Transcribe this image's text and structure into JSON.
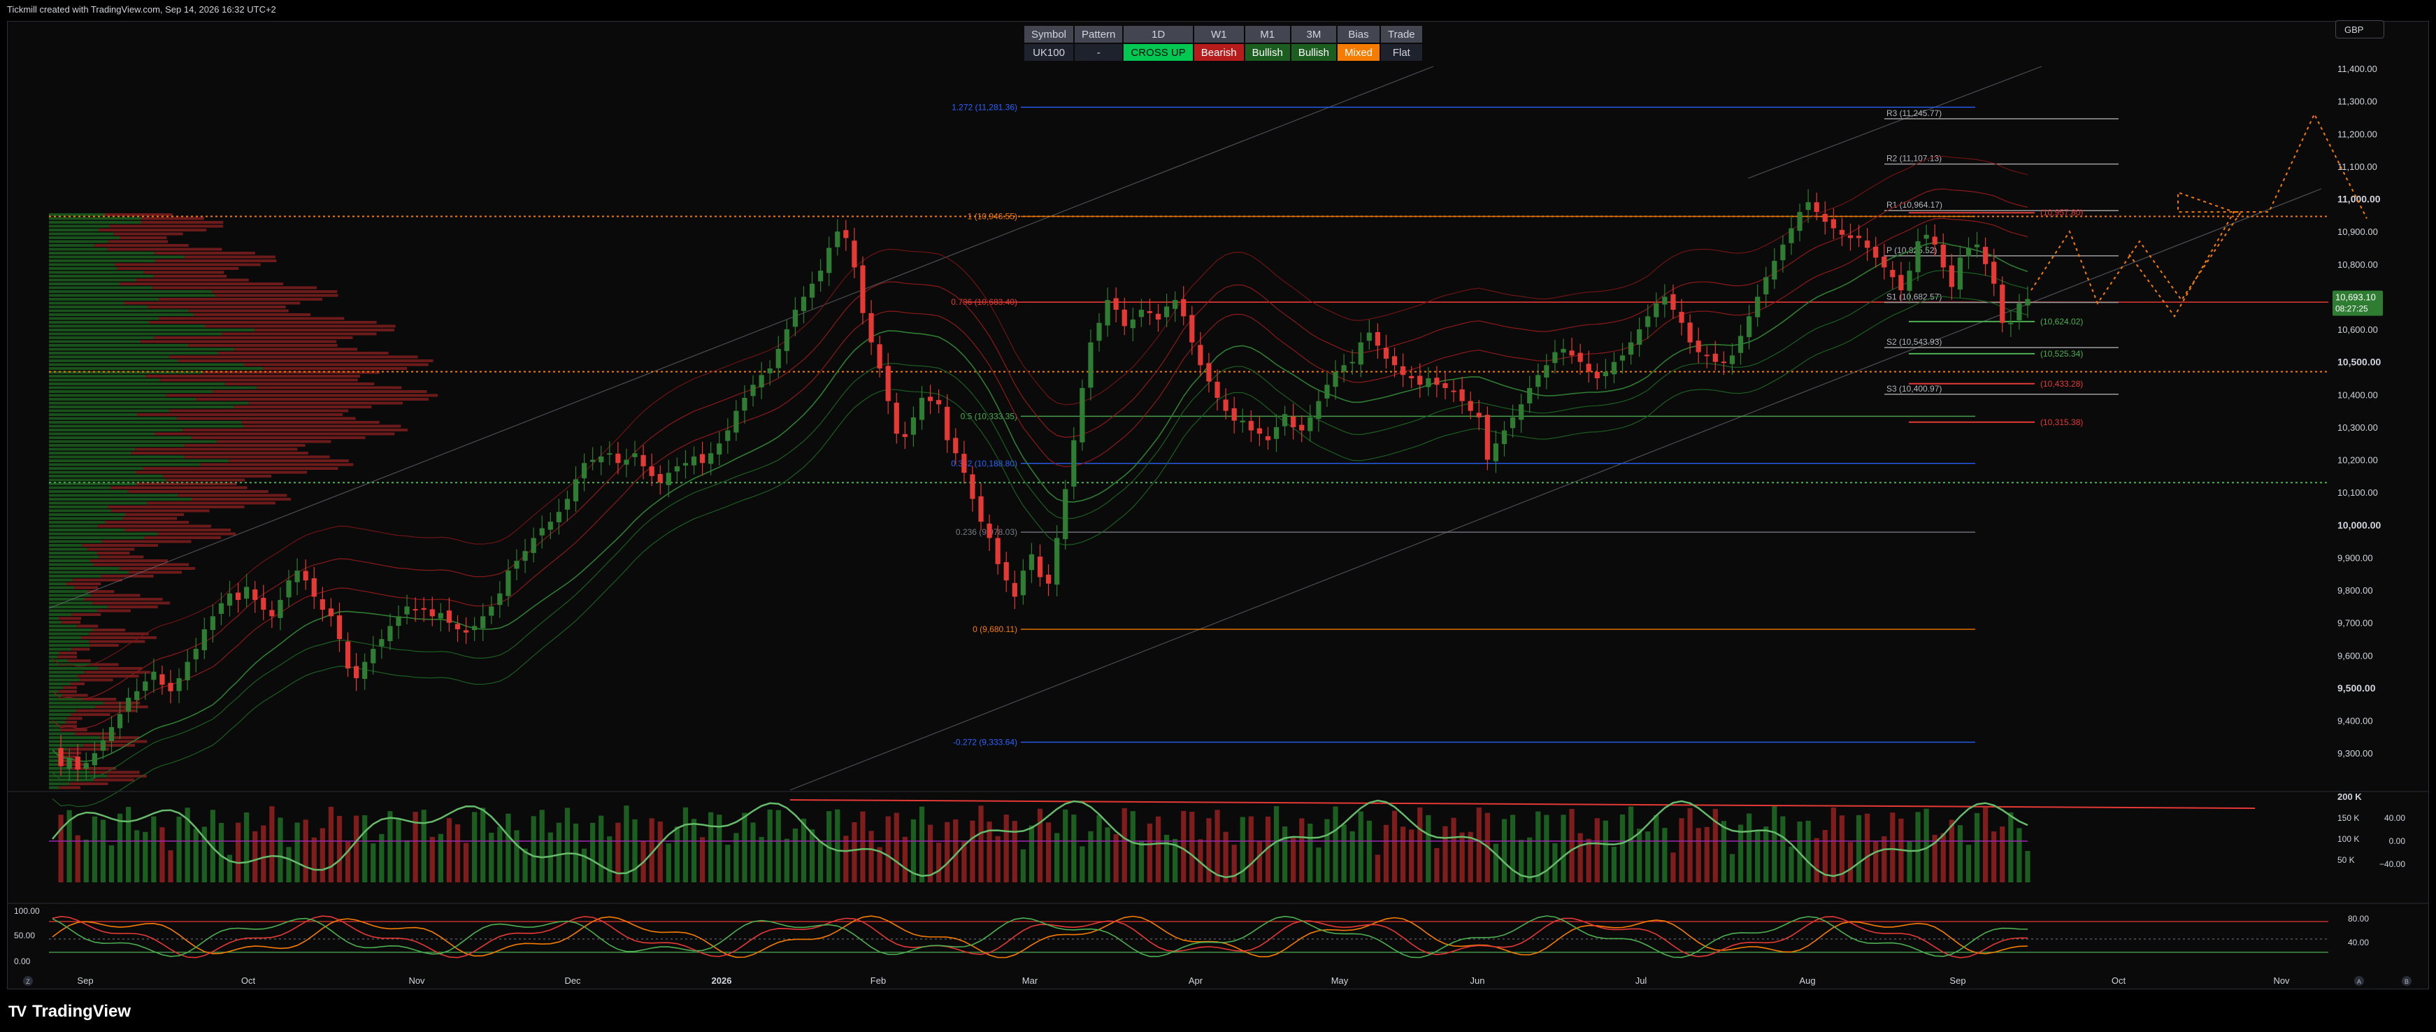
{
  "header": {
    "credit": "Tickmill created with TradingView.com, Sep 14, 2026 16:32 UTC+2"
  },
  "currency": "GBP",
  "signal_table": {
    "headers": [
      "Symbol",
      "Pattern",
      "1D",
      "W1",
      "M1",
      "3M",
      "Bias",
      "Trade"
    ],
    "values": [
      "UK100",
      "-",
      "CROSS UP",
      "Bearish",
      "Bullish",
      "Bullish",
      "Mixed",
      "Flat"
    ],
    "value_styles": [
      "",
      "",
      "green",
      "red",
      "dkgreen",
      "dkgreen",
      "orange",
      ""
    ]
  },
  "brand": {
    "name": "TradingView",
    "logo": "TV"
  },
  "colors": {
    "bull": "#26a69a",
    "candle_up": "#2e7d32",
    "candle_down": "#e53935",
    "accent_orange": "#f57c00",
    "fib_blue": "#2962ff"
  },
  "chart_data": {
    "type": "candlestick",
    "symbol": "UK100",
    "y_ticks": [
      "11,400.00",
      "11,300.00",
      "11,200.00",
      "11,100.00",
      "11,000.00",
      "10,900.00",
      "10,800.00",
      "10,700.00",
      "10,600.00",
      "10,500.00",
      "10,400.00",
      "10,300.00",
      "10,200.00",
      "10,100.00",
      "10,000.00",
      "9,900.00",
      "9,800.00",
      "9,700.00",
      "9,600.00",
      "9,500.00",
      "9,400.00",
      "9,300.00"
    ],
    "ylim": [
      9240,
      11440
    ],
    "x_ticks": [
      "Sep",
      "Oct",
      "Nov",
      "Dec",
      "2026",
      "Feb",
      "Mar",
      "Apr",
      "May",
      "Jun",
      "Jul",
      "Aug",
      "Sep",
      "Oct",
      "Nov"
    ],
    "last_price": {
      "value": "10,693.10",
      "countdown": "08:27:25"
    },
    "fib_levels": [
      {
        "label": "1.272 (11,281.36)",
        "value": 11281.36,
        "color": "#2962ff"
      },
      {
        "label": "1 (10,946.55)",
        "value": 10946.55,
        "color": "#f57c00"
      },
      {
        "label": "0.786 (10,683.40)",
        "value": 10683.4,
        "color": "#e53935"
      },
      {
        "label": "0.5 (10,333.35)",
        "value": 10333.35,
        "color": "#4caf50"
      },
      {
        "label": "0.382 (10,188.80)",
        "value": 10188.8,
        "color": "#2962ff"
      },
      {
        "label": "0.236 (9,978.03)",
        "value": 9978.03,
        "color": "#787b86"
      },
      {
        "label": "0 (9,680.11)",
        "value": 9680.11,
        "color": "#f57c00"
      },
      {
        "label": "-0.272 (9,333.64)",
        "value": 9333.64,
        "color": "#2962ff"
      }
    ],
    "pivot_levels": [
      {
        "label": "R3 (11,245.77)",
        "value": 11245.77
      },
      {
        "label": "R2 (11,107.13)",
        "value": 11107.13
      },
      {
        "label": "R1 (10,964.17)",
        "value": 10964.17
      },
      {
        "label": "P (10,825.52)",
        "value": 10825.52
      },
      {
        "label": "S1 (10,682.57)",
        "value": 10682.57
      },
      {
        "label": "S2 (10,543.93)",
        "value": 10543.93
      },
      {
        "label": "S3 (10,400.97)",
        "value": 10400.97
      }
    ],
    "target_levels": [
      {
        "label": "(10,957.80)",
        "value": 10957.8,
        "color": "#e53935"
      },
      {
        "label": "(10,624.02)",
        "value": 10624.02,
        "color": "#4caf50"
      },
      {
        "label": "(10,525.34)",
        "value": 10525.34,
        "color": "#4caf50"
      },
      {
        "label": "(10,433.28)",
        "value": 10433.28,
        "color": "#e53935"
      },
      {
        "label": "(10,315.38)",
        "value": 10315.38,
        "color": "#e53935"
      }
    ],
    "volume_panel": {
      "y_ticks": [
        "200 K",
        "150 K",
        "100 K",
        "50 K"
      ],
      "osc_ticks": [
        "40.00",
        "0.00",
        "−40.00"
      ]
    },
    "stoch_panel": {
      "left_ticks": [
        "100.00",
        "50.00",
        "0.00"
      ],
      "right_ticks": [
        "80.00",
        "40.00"
      ]
    },
    "bottom_icons": [
      "Z",
      "A",
      "B"
    ],
    "closes": [
      9310,
      9260,
      9285,
      9250,
      9270,
      9300,
      9340,
      9380,
      9420,
      9470,
      9490,
      9520,
      9550,
      9510,
      9490,
      9530,
      9580,
      9620,
      9680,
      9720,
      9760,
      9790,
      9770,
      9810,
      9770,
      9740,
      9720,
      9770,
      9830,
      9860,
      9830,
      9780,
      9740,
      9720,
      9650,
      9560,
      9530,
      9580,
      9620,
      9650,
      9690,
      9720,
      9750,
      9740,
      9740,
      9720,
      9730,
      9700,
      9680,
      9670,
      9690,
      9720,
      9750,
      9790,
      9860,
      9890,
      9920,
      9960,
      9990,
      10010,
      10040,
      10080,
      10140,
      10190,
      10200,
      10210,
      10220,
      10190,
      10200,
      10220,
      10180,
      10150,
      10130,
      10160,
      10180,
      10190,
      10210,
      10190,
      10220,
      10250,
      10290,
      10350,
      10390,
      10430,
      10460,
      10480,
      10540,
      10600,
      10660,
      10700,
      10740,
      10780,
      10850,
      10900,
      10880,
      10790,
      10650,
      10560,
      10480,
      10380,
      10280,
      10270,
      10330,
      10390,
      10380,
      10370,
      10260,
      10220,
      10160,
      10080,
      10010,
      9960,
      9880,
      9830,
      9780,
      9860,
      9910,
      9840,
      9820,
      9960,
      10110,
      10260,
      10420,
      10560,
      10620,
      10690,
      10660,
      10610,
      10630,
      10660,
      10650,
      10630,
      10670,
      10690,
      10640,
      10560,
      10490,
      10440,
      10390,
      10350,
      10320,
      10320,
      10290,
      10280,
      10260,
      10300,
      10340,
      10300,
      10290,
      10330,
      10380,
      10430,
      10470,
      10490,
      10500,
      10560,
      10590,
      10550,
      10510,
      10490,
      10460,
      10450,
      10430,
      10450,
      10430,
      10420,
      10410,
      10380,
      10350,
      10330,
      10200,
      10250,
      10290,
      10330,
      10370,
      10420,
      10460,
      10490,
      10530,
      10540,
      10520,
      10500,
      10470,
      10450,
      10470,
      10500,
      10520,
      10560,
      10600,
      10640,
      10680,
      10700,
      10660,
      10620,
      10560,
      10530,
      10520,
      10500,
      10500,
      10520,
      10580,
      10640,
      10700,
      10760,
      10810,
      10860,
      10910,
      10960,
      10990,
      10960,
      10930,
      10910,
      10890,
      10880,
      10880,
      10850,
      10820,
      10790,
      10760,
      10720,
      10780,
      10870,
      10890,
      10860,
      10790,
      10730,
      10820,
      10850,
      10860,
      10800,
      10740,
      10620,
      10620,
      10680,
      10693.1
    ],
    "volume_profile_note": "horizontal volume-by-price histogram on left"
  }
}
